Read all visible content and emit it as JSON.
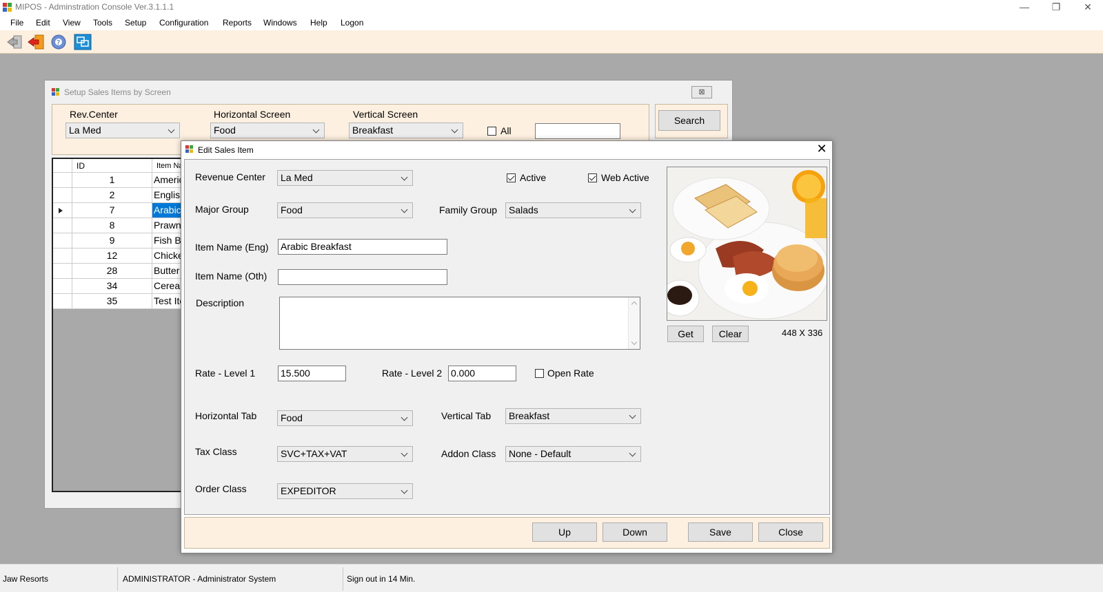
{
  "app": {
    "title": "MIPOS - Adminstration Console Ver.3.1.1.1",
    "controls": {
      "minimize": "—",
      "restore": "❐",
      "close": "✕"
    }
  },
  "menu": [
    "File",
    "Edit",
    "View",
    "Tools",
    "Setup",
    "Configuration",
    "Reports",
    "Windows",
    "Help",
    "Logon"
  ],
  "toolbar": {
    "icons": [
      "exit-icon",
      "logout-icon",
      "help-icon",
      "window-switch-icon"
    ]
  },
  "setup_window": {
    "title": "Setup Sales Items by Screen",
    "rev_center_label": "Rev.Center",
    "rev_center_value": "La Med",
    "horizontal_label": "Horizontal Screen",
    "horizontal_value": "Food",
    "vertical_label": "Vertical Screen",
    "vertical_value": "Breakfast",
    "all_label": "All",
    "all_checked": false,
    "search_text": "",
    "search_button": "Search",
    "grid": {
      "columns": [
        "ID",
        "Item Na"
      ],
      "rows": [
        {
          "id": "1",
          "name": "Americ"
        },
        {
          "id": "2",
          "name": "English"
        },
        {
          "id": "7",
          "name": "Arabic",
          "selected": true
        },
        {
          "id": "8",
          "name": "Prawn"
        },
        {
          "id": "9",
          "name": "Fish Bi"
        },
        {
          "id": "12",
          "name": "Chicke"
        },
        {
          "id": "28",
          "name": "Butter M"
        },
        {
          "id": "34",
          "name": "Cereal"
        },
        {
          "id": "35",
          "name": "Test Ite"
        }
      ]
    }
  },
  "edit_dialog": {
    "title": "Edit Sales Item",
    "close_glyph": "✕",
    "revenue_center_label": "Revenue Center",
    "revenue_center_value": "La Med",
    "active_label": "Active",
    "active_checked": true,
    "web_active_label": "Web Active",
    "web_active_checked": true,
    "major_group_label": "Major Group",
    "major_group_value": "Food",
    "family_group_label": "Family Group",
    "family_group_value": "Salads",
    "item_name_eng_label": "Item Name (Eng)",
    "item_name_eng_value": "Arabic Breakfast",
    "item_name_oth_label": "Item Name (Oth)",
    "item_name_oth_value": "",
    "description_label": "Description",
    "description_value": "",
    "rate1_label": "Rate - Level 1",
    "rate1_value": "15.500",
    "rate2_label": "Rate - Level 2",
    "rate2_value": "0.000",
    "open_rate_label": "Open Rate",
    "open_rate_checked": false,
    "horizontal_tab_label": "Horizontal Tab",
    "horizontal_tab_value": "Food",
    "vertical_tab_label": "Vertical Tab",
    "vertical_tab_value": "Breakfast",
    "tax_class_label": "Tax Class",
    "tax_class_value": "SVC+TAX+VAT",
    "addon_class_label": "Addon Class",
    "addon_class_value": "None - Default",
    "order_class_label": "Order Class",
    "order_class_value": "EXPEDITOR",
    "image_get": "Get",
    "image_clear": "Clear",
    "image_size": "448 X 336",
    "buttons": {
      "up": "Up",
      "down": "Down",
      "save": "Save",
      "close": "Close"
    }
  },
  "status": {
    "company": "Jaw Resorts",
    "user": "ADMINISTRATOR - Administrator System",
    "signout": "Sign out in 14 Min."
  },
  "colors": {
    "panel_beige": "#fdf0e0",
    "desktop_gray": "#a9a9a9",
    "selection_blue": "#0078d7"
  }
}
